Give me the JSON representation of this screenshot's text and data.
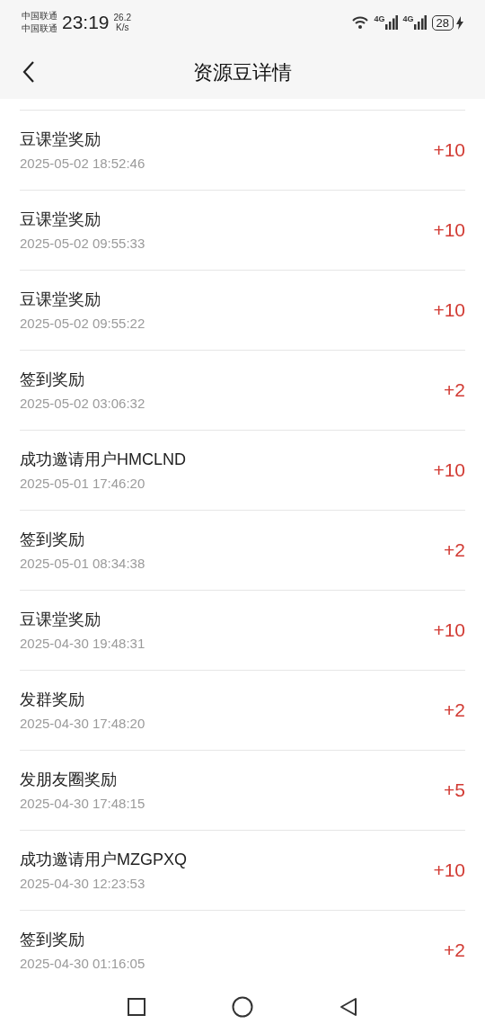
{
  "status_bar": {
    "carriers": [
      "中国联通",
      "中国联通"
    ],
    "time": "23:19",
    "speed_value": "26.2",
    "speed_unit": "K/s",
    "network_labels": [
      "4G",
      "4G"
    ],
    "battery": "28",
    "charging": true
  },
  "header": {
    "title": "资源豆详情"
  },
  "records": [
    {
      "title": "豆课堂奖励",
      "time": "2025-05-02 18:52:46",
      "amount": "+10"
    },
    {
      "title": "豆课堂奖励",
      "time": "2025-05-02 09:55:33",
      "amount": "+10"
    },
    {
      "title": "豆课堂奖励",
      "time": "2025-05-02 09:55:22",
      "amount": "+10"
    },
    {
      "title": "签到奖励",
      "time": "2025-05-02 03:06:32",
      "amount": "+2"
    },
    {
      "title": "成功邀请用户HMCLND",
      "time": "2025-05-01 17:46:20",
      "amount": "+10"
    },
    {
      "title": "签到奖励",
      "time": "2025-05-01 08:34:38",
      "amount": "+2"
    },
    {
      "title": "豆课堂奖励",
      "time": "2025-04-30 19:48:31",
      "amount": "+10"
    },
    {
      "title": "发群奖励",
      "time": "2025-04-30 17:48:20",
      "amount": "+2"
    },
    {
      "title": "发朋友圈奖励",
      "time": "2025-04-30 17:48:15",
      "amount": "+5"
    },
    {
      "title": "成功邀请用户MZGPXQ",
      "time": "2025-04-30 12:23:53",
      "amount": "+10"
    },
    {
      "title": "签到奖励",
      "time": "2025-04-30 01:16:05",
      "amount": "+2"
    }
  ]
}
